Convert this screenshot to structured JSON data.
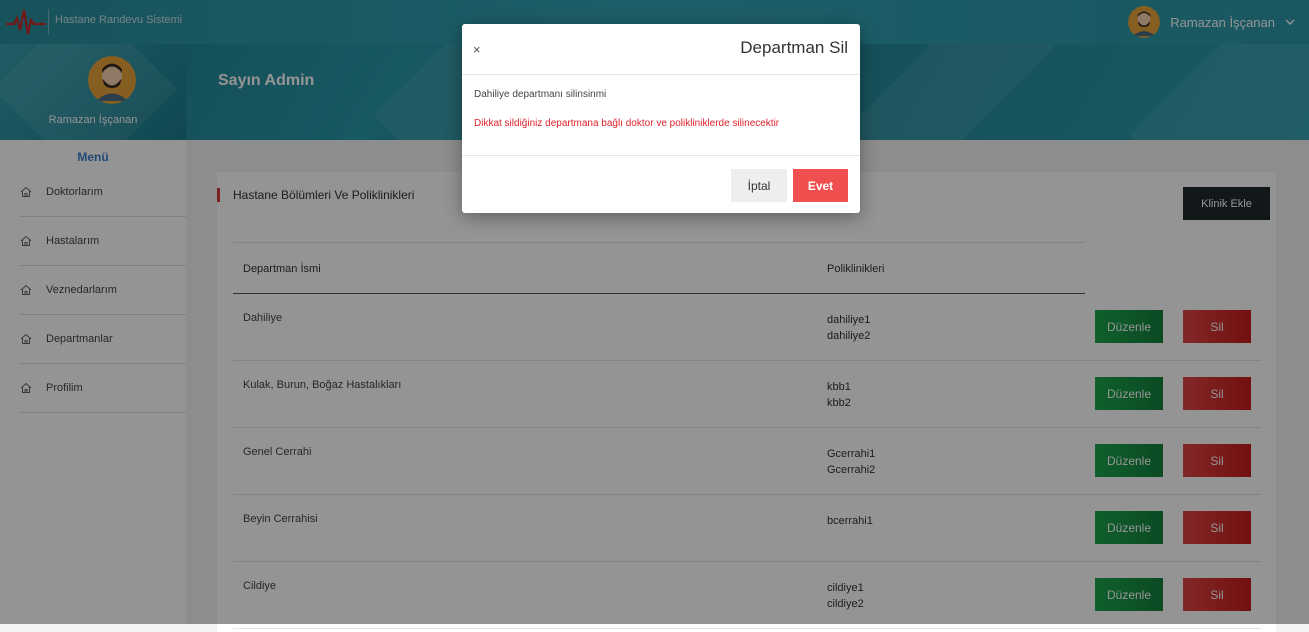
{
  "header": {
    "app_title": "Hastane Randevu Sistemi",
    "user_name": "Ramazan İşçanan"
  },
  "profile": {
    "name": "Ramazan İşçanan",
    "welcome": "Sayın Admin"
  },
  "sidebar": {
    "title": "Menü",
    "items": [
      {
        "label": "Doktorlarım",
        "icon": "home-icon"
      },
      {
        "label": "Hastalarım",
        "icon": "home-icon"
      },
      {
        "label": "Veznedarlarım",
        "icon": "home-icon"
      },
      {
        "label": "Departmanlar",
        "icon": "home-icon"
      },
      {
        "label": "Profilim",
        "icon": "home-icon"
      }
    ]
  },
  "main": {
    "title": "Hastane Bölümleri Ve Poliklinikleri",
    "add_button": "Klinik Ekle",
    "columns": [
      "Departman İsmi",
      "Poliklinikleri"
    ],
    "edit_label": "Düzenle",
    "delete_label": "Sil",
    "rows": [
      {
        "name": "Dahiliye",
        "polis": [
          "dahiliye1",
          "dahiliye2"
        ]
      },
      {
        "name": "Kulak, Burun, Boğaz Hastalıkları",
        "polis": [
          "kbb1",
          "kbb2"
        ]
      },
      {
        "name": "Genel Cerrahi",
        "polis": [
          "Gcerrahi1",
          "Gcerrahi2"
        ]
      },
      {
        "name": "Beyin Cerrahisi",
        "polis": [
          "bcerrahi1",
          ""
        ]
      },
      {
        "name": "Cildiye",
        "polis": [
          "cildiye1",
          "cildiye2"
        ]
      }
    ]
  },
  "modal": {
    "close": "×",
    "title": "Departman Sil",
    "message": "Dahiliye departmanı silinsinmi",
    "warning": "Dikkat sildiğiniz departmana bağlı doktor ve polikliniklerde silinecektir",
    "cancel": "İptal",
    "confirm": "Evet"
  },
  "colors": {
    "header": "#2d97a8",
    "accent_red": "#f04f4f",
    "edit_green": "#1ba54e",
    "menu_blue": "#3a7fc8"
  }
}
